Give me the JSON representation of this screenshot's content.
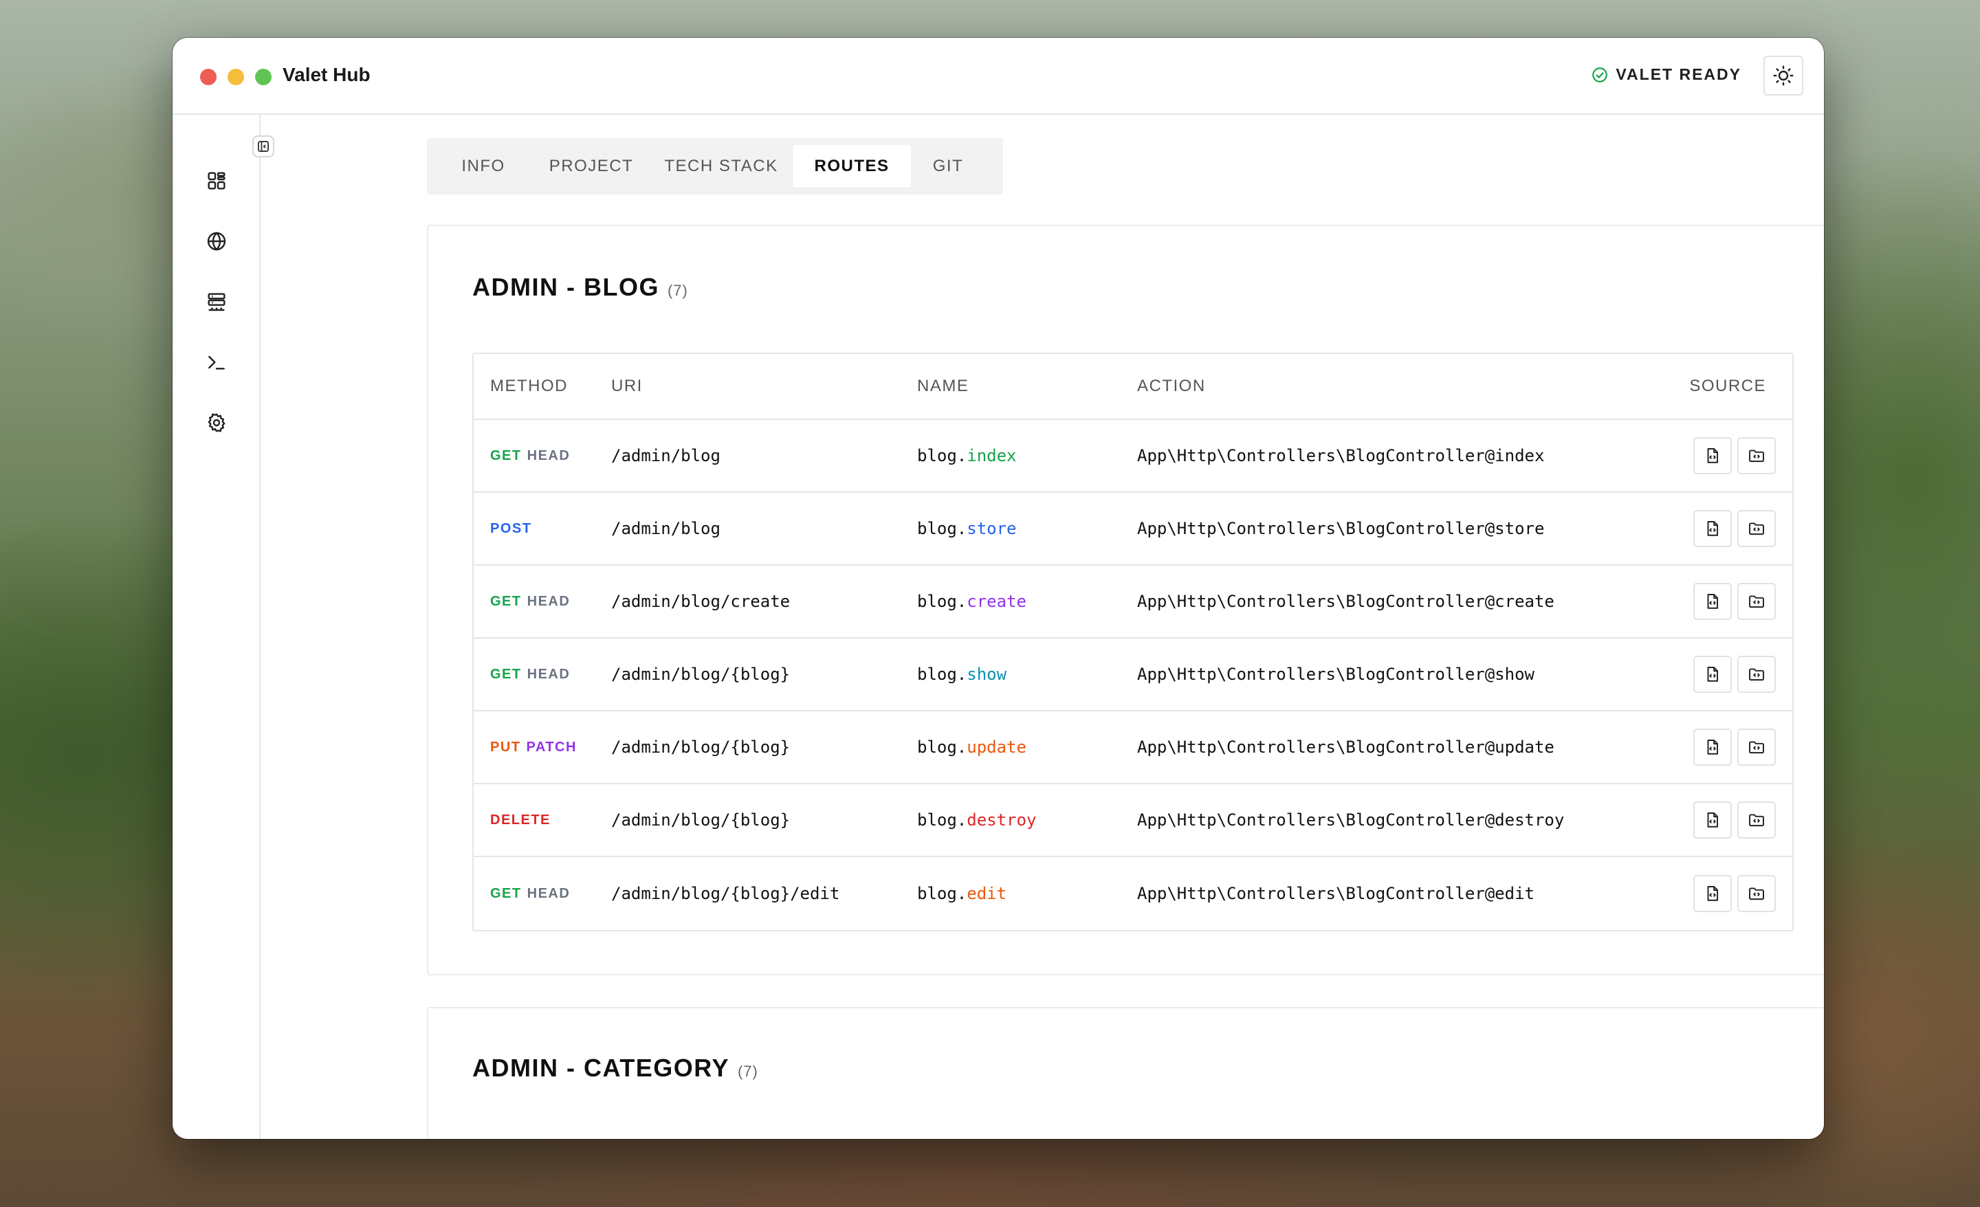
{
  "window": {
    "title": "Valet Hub"
  },
  "status": {
    "label": "VALET READY",
    "color": "#16a34a"
  },
  "sidebar": {
    "items": [
      {
        "icon": "dashboard-icon"
      },
      {
        "icon": "globe-icon"
      },
      {
        "icon": "server-icon"
      },
      {
        "icon": "terminal-icon"
      },
      {
        "icon": "gear-icon"
      }
    ]
  },
  "tabs": [
    {
      "label": "INFO",
      "active": false
    },
    {
      "label": "PROJECT",
      "active": false
    },
    {
      "label": "TECH STACK",
      "active": false
    },
    {
      "label": "ROUTES",
      "active": true
    },
    {
      "label": "GIT",
      "active": false
    }
  ],
  "groups": [
    {
      "title": "ADMIN - BLOG",
      "count": "(7)",
      "columns": [
        "METHOD",
        "URI",
        "NAME",
        "ACTION",
        "SOURCE"
      ],
      "routes": [
        {
          "methods": [
            "GET",
            "HEAD"
          ],
          "uri": "/admin/blog",
          "name_prefix": "blog.",
          "name_suffix": "index",
          "action": "App\\Http\\Controllers\\BlogController@index"
        },
        {
          "methods": [
            "POST"
          ],
          "uri": "/admin/blog",
          "name_prefix": "blog.",
          "name_suffix": "store",
          "action": "App\\Http\\Controllers\\BlogController@store"
        },
        {
          "methods": [
            "GET",
            "HEAD"
          ],
          "uri": "/admin/blog/create",
          "name_prefix": "blog.",
          "name_suffix": "create",
          "action": "App\\Http\\Controllers\\BlogController@create"
        },
        {
          "methods": [
            "GET",
            "HEAD"
          ],
          "uri": "/admin/blog/{blog}",
          "name_prefix": "blog.",
          "name_suffix": "show",
          "action": "App\\Http\\Controllers\\BlogController@show"
        },
        {
          "methods": [
            "PUT",
            "PATCH"
          ],
          "uri": "/admin/blog/{blog}",
          "name_prefix": "blog.",
          "name_suffix": "update",
          "action": "App\\Http\\Controllers\\BlogController@update"
        },
        {
          "methods": [
            "DELETE"
          ],
          "uri": "/admin/blog/{blog}",
          "name_prefix": "blog.",
          "name_suffix": "destroy",
          "action": "App\\Http\\Controllers\\BlogController@destroy"
        },
        {
          "methods": [
            "GET",
            "HEAD"
          ],
          "uri": "/admin/blog/{blog}/edit",
          "name_prefix": "blog.",
          "name_suffix": "edit",
          "action": "App\\Http\\Controllers\\BlogController@edit"
        }
      ]
    },
    {
      "title": "ADMIN - CATEGORY",
      "count": "(7)"
    }
  ],
  "colors": {
    "GET": "#16a34a",
    "HEAD": "#6b7280",
    "POST": "#2563eb",
    "PUT": "#ea580c",
    "PATCH": "#9333ea",
    "DELETE": "#dc2626",
    "name_index": "#16a34a",
    "name_store": "#2563eb",
    "name_create": "#9333ea",
    "name_show": "#0891b2",
    "name_update": "#ea580c",
    "name_destroy": "#dc2626",
    "name_edit": "#ea580c"
  }
}
